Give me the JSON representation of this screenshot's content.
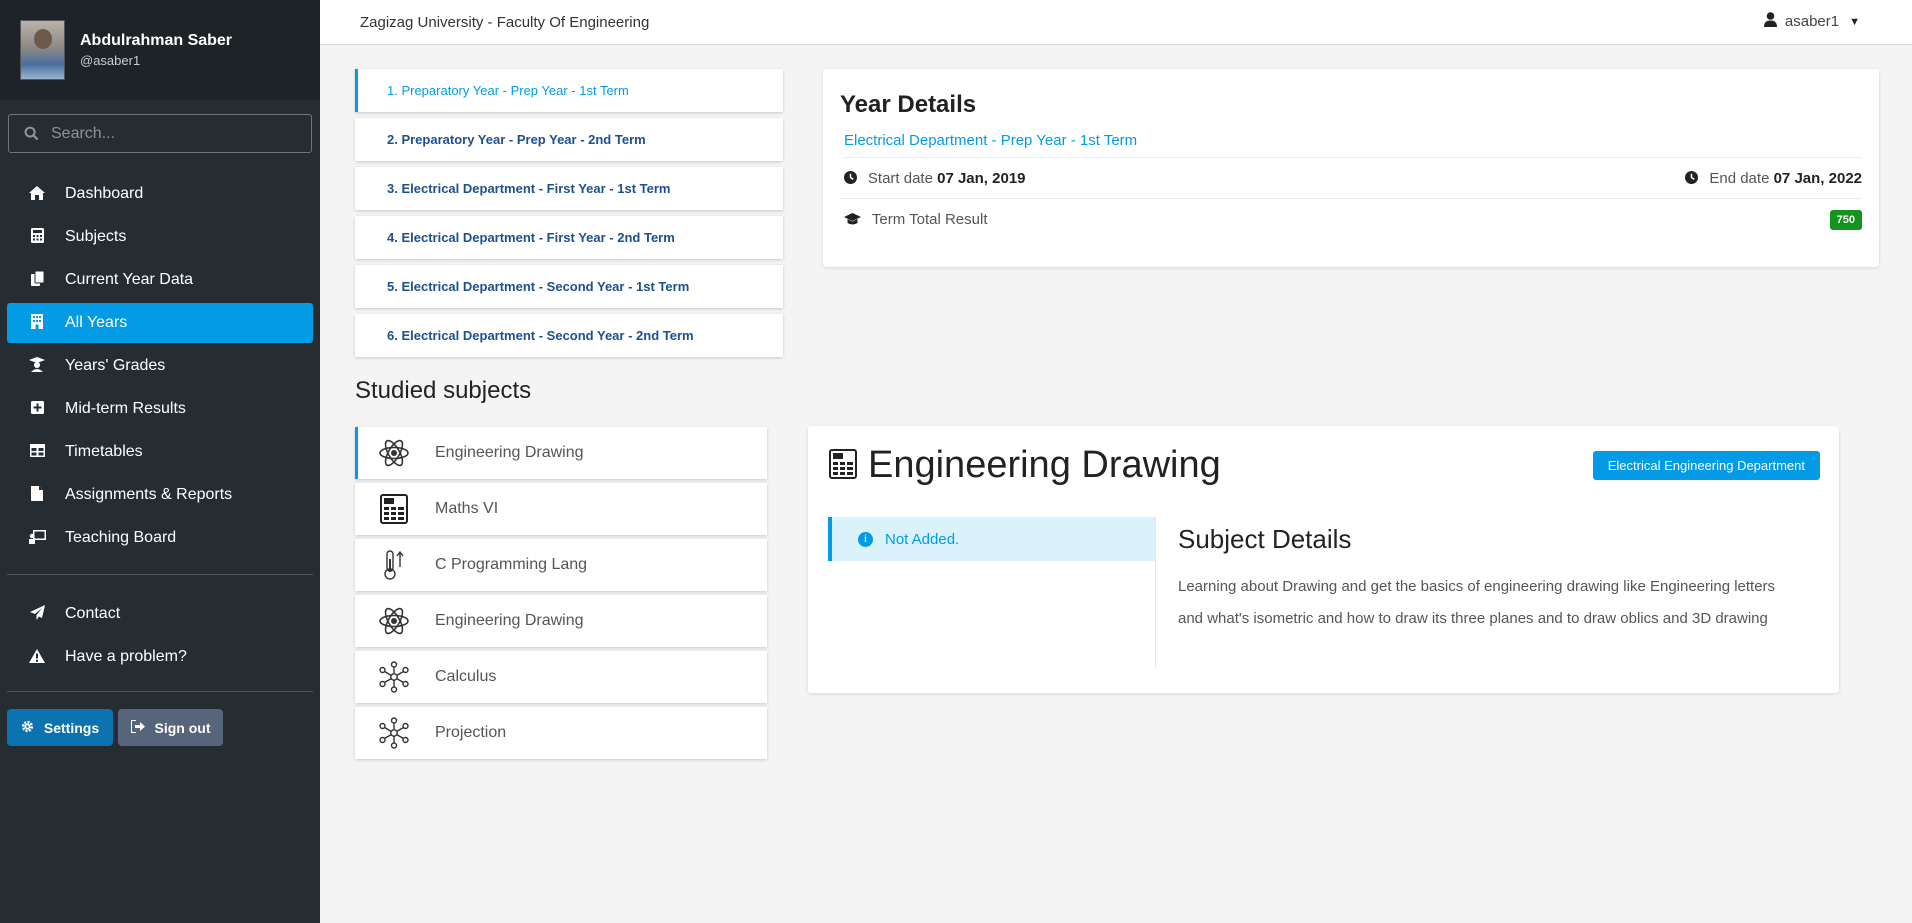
{
  "profile": {
    "name": "Abdulrahman Saber",
    "handle": "@asaber1"
  },
  "search": {
    "placeholder": "Search..."
  },
  "nav": {
    "items": [
      {
        "label": "Dashboard",
        "icon": "home-icon"
      },
      {
        "label": "Subjects",
        "icon": "calculator-icon"
      },
      {
        "label": "Current Year Data",
        "icon": "copy-icon"
      },
      {
        "label": "All Years",
        "icon": "building-icon",
        "active": true
      },
      {
        "label": "Years' Grades",
        "icon": "graduate-icon"
      },
      {
        "label": "Mid-term Results",
        "icon": "plus-square-icon"
      },
      {
        "label": "Timetables",
        "icon": "table-icon"
      },
      {
        "label": "Assignments & Reports",
        "icon": "file-icon"
      },
      {
        "label": "Teaching Board",
        "icon": "chalkboard-icon"
      }
    ],
    "secondary": [
      {
        "label": "Contact",
        "icon": "paper-plane-icon"
      },
      {
        "label": "Have a problem?",
        "icon": "warning-icon"
      }
    ]
  },
  "buttons": {
    "settings": "Settings",
    "signout": "Sign out"
  },
  "topbar": {
    "title": "Zagizag University - Faculty Of Engineering",
    "username": "asaber1"
  },
  "years": [
    "1. Preparatory Year - Prep Year - 1st Term",
    "2. Preparatory Year - Prep Year - 2nd Term",
    "3. Electrical Department - First Year - 1st Term",
    "4. Electrical Department - First Year - 2nd Term",
    "5. Electrical Department - Second Year - 1st Term",
    "6. Electrical Department - Second Year - 2nd Term"
  ],
  "year_details": {
    "title": "Year Details",
    "link": "Electrical Department - Prep Year - 1st Term",
    "start_label": "Start date",
    "start_value": "07 Jan, 2019",
    "end_label": "End date",
    "end_value": "07 Jan, 2022",
    "total_label": "Term Total Result",
    "total_value": "750"
  },
  "studied": {
    "title": "Studied subjects",
    "items": [
      {
        "label": "Engineering Drawing",
        "icon": "atom-icon"
      },
      {
        "label": "Maths VI",
        "icon": "calculator-icon"
      },
      {
        "label": "C Programming Lang",
        "icon": "thermometer-icon"
      },
      {
        "label": "Engineering Drawing",
        "icon": "atom-icon"
      },
      {
        "label": "Calculus",
        "icon": "network-icon"
      },
      {
        "label": "Projection",
        "icon": "network-icon"
      }
    ]
  },
  "subject_card": {
    "title": "Engineering Drawing",
    "department": "Electrical Engineering Department",
    "status": "Not Added.",
    "details_title": "Subject Details",
    "details_text": "Learning about Drawing and get the basics of engineering drawing like Engineering letters and what's isometric and how to draw its three planes and to draw oblics and 3D drawing"
  },
  "colors": {
    "accent": "#039be5",
    "sidebar": "#252d33",
    "success": "#12941e",
    "link": "#1d4f91"
  }
}
